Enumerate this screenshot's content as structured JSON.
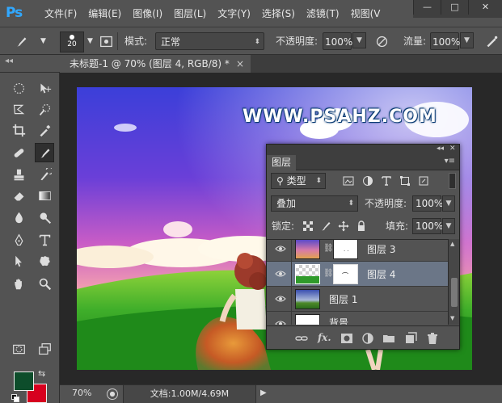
{
  "app": {
    "logo": "Ps"
  },
  "menu": [
    "文件(F)",
    "编辑(E)",
    "图像(I)",
    "图层(L)",
    "文字(Y)",
    "选择(S)",
    "滤镜(T)",
    "视图(V"
  ],
  "window_controls": {
    "minimize": "—",
    "maximize": "□",
    "close": "✕"
  },
  "options": {
    "brush_size": "20",
    "mode_label": "模式:",
    "mode_value": "正常",
    "opacity_label": "不透明度:",
    "opacity_value": "100%",
    "flow_label": "流量:",
    "flow_value": "100%"
  },
  "document": {
    "tab_title": "未标题-1 @ 70% (图层 4, RGB/8) *",
    "tab_close": "×"
  },
  "canvas": {
    "watermark": "WWW.PSAHZ.COM"
  },
  "colors": {
    "foreground": "#0d4d2b",
    "background": "#d7001f"
  },
  "status": {
    "zoom": "70%",
    "doc_info": "文档:1.00M/4.69M"
  },
  "layers_panel": {
    "tab": "图层",
    "filter_label": "类型",
    "blend_mode": "叠加",
    "opacity_label": "不透明度:",
    "opacity_value": "100%",
    "lock_label": "锁定:",
    "fill_label": "填充:",
    "fill_value": "100%",
    "layers": [
      {
        "name": "图层 3",
        "selected": false,
        "has_mask": true
      },
      {
        "name": "图层 4",
        "selected": true,
        "has_mask": true
      },
      {
        "name": "图层 1",
        "selected": false,
        "has_mask": false
      },
      {
        "name": "背景",
        "selected": false,
        "has_mask": false
      }
    ]
  }
}
